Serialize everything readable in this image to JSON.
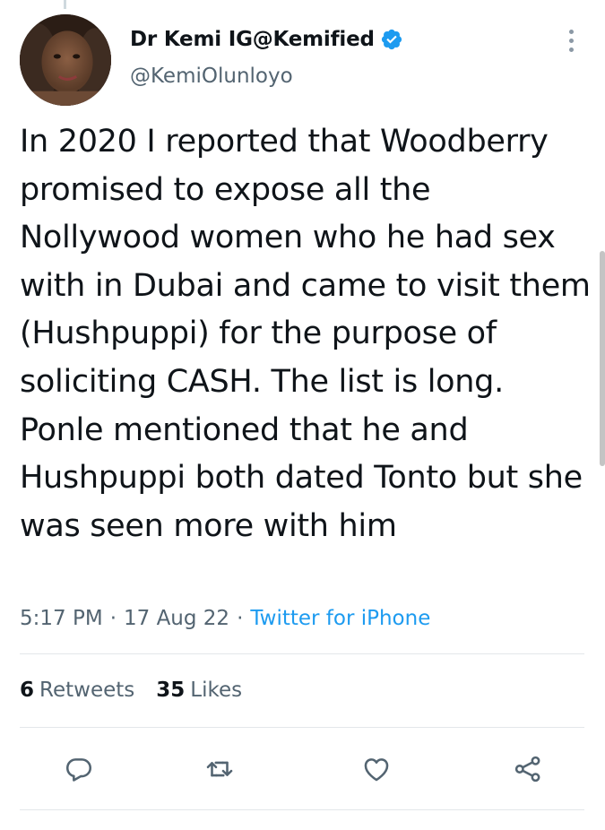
{
  "tweet": {
    "display_name": "Dr Kemi IG@Kemified",
    "handle": "@KemiOlunloyo",
    "text": "In 2020 I reported that Woodberry promised to expose all the Nollywood women who he had sex with in Dubai and came to visit them (Hushpuppi) for the purpose of soliciting CASH. The list is long. Ponle mentioned that he and Hushpuppi both dated Tonto but she was seen more with him",
    "time": "5:17 PM",
    "date": "17 Aug 22",
    "separator": "·",
    "source": "Twitter for iPhone"
  },
  "stats": {
    "retweets_count": "6",
    "retweets_label": "Retweets",
    "likes_count": "35",
    "likes_label": "Likes"
  },
  "icons": {
    "verified": "verified-badge-icon",
    "more": "more-vertical-icon",
    "reply": "reply-icon",
    "retweet": "retweet-icon",
    "like": "heart-icon",
    "share": "share-icon"
  },
  "colors": {
    "text": "#0f1419",
    "secondary": "#536471",
    "link": "#1d9bf0",
    "verified": "#1d9bf0",
    "divider": "#e3e7ea"
  }
}
